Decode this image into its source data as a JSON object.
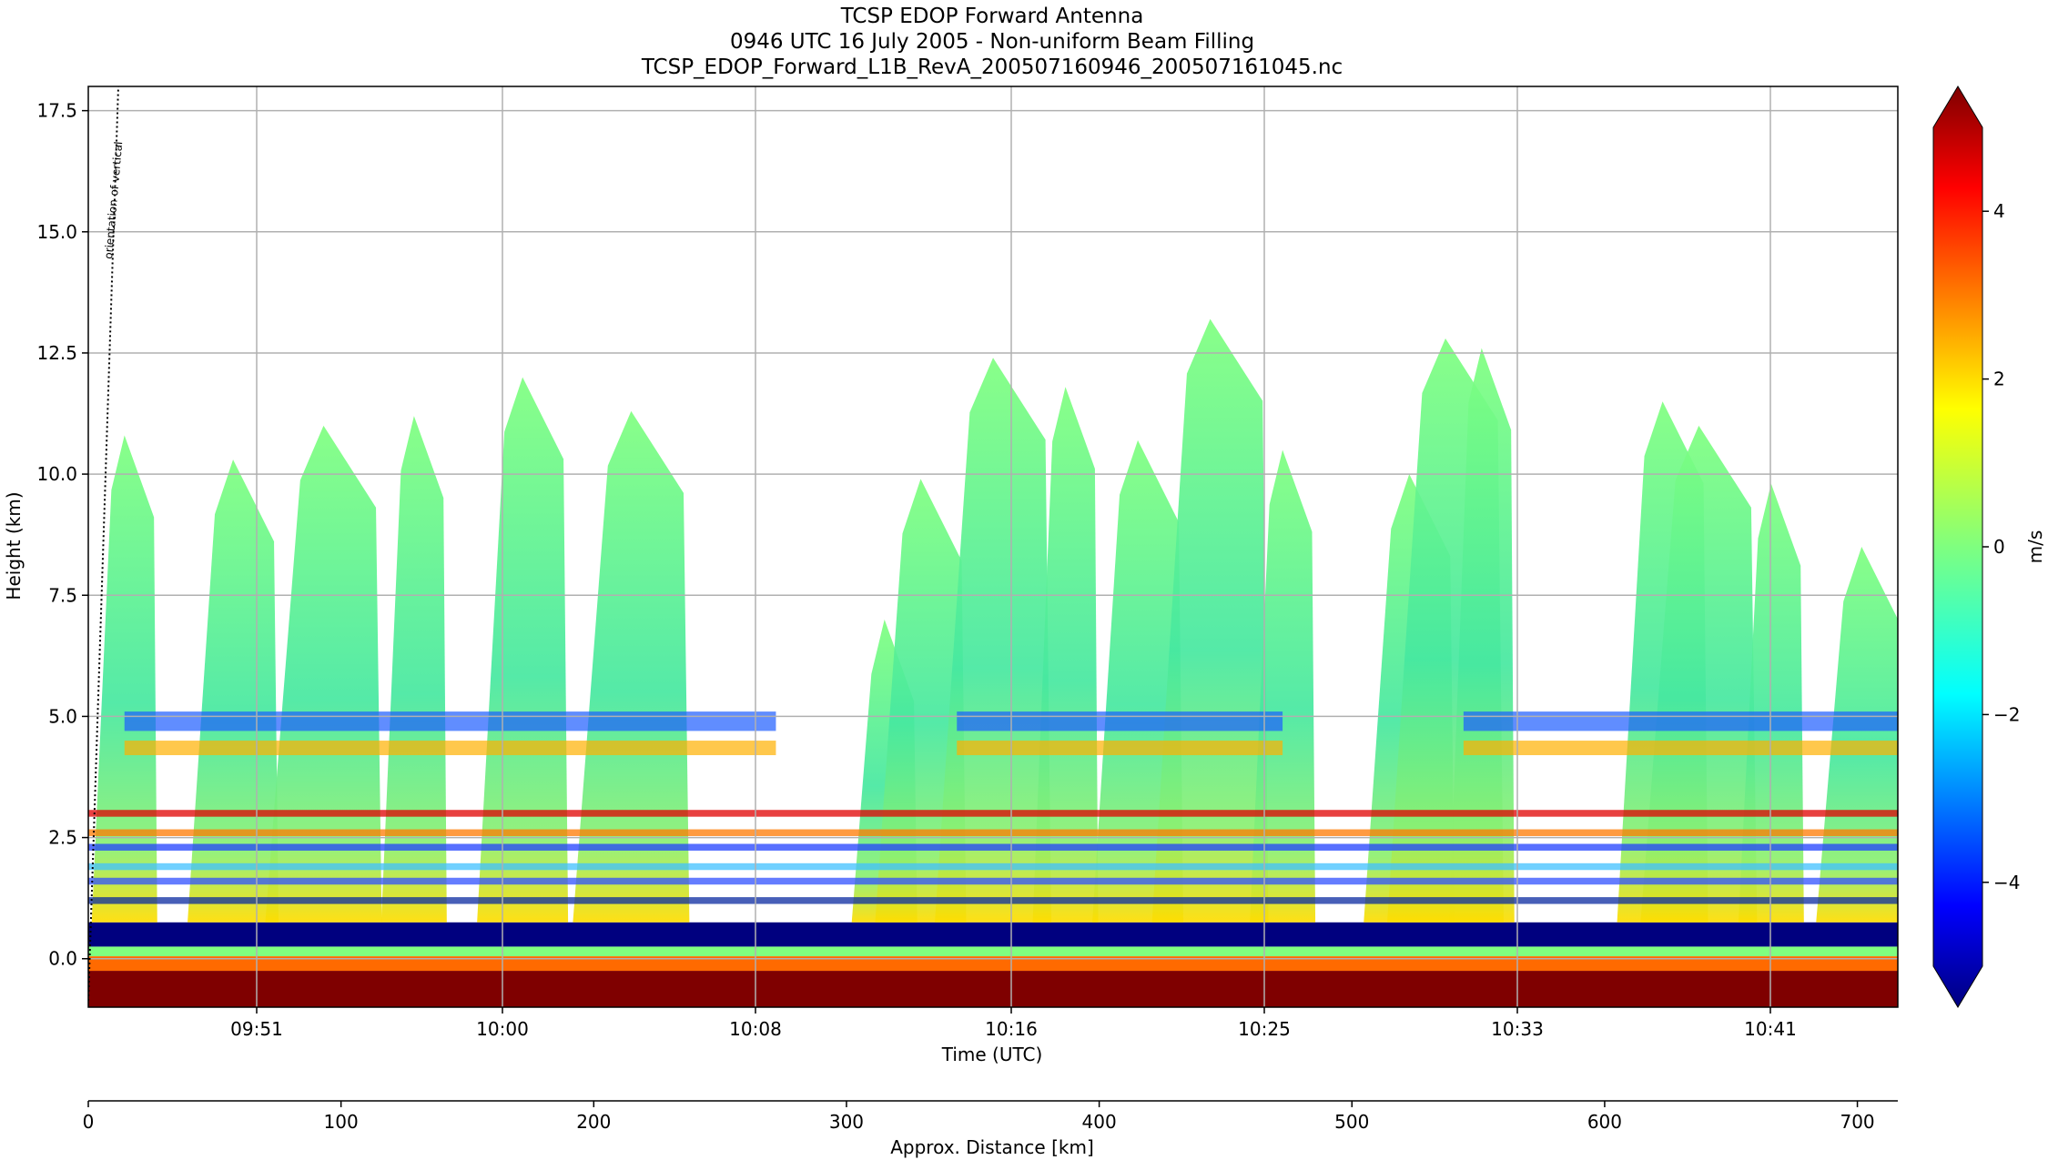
{
  "chart_data": {
    "type": "heatmap",
    "title_lines": [
      "TCSP EDOP Forward Antenna",
      "0946 UTC 16 July 2005 - Non-uniform Beam Filling",
      "TCSP_EDOP_Forward_L1B_RevA_200507160946_200507161045.nc"
    ],
    "xlabel": "Time (UTC)",
    "ylabel": "Height (km)",
    "x_ticks": [
      "09:51",
      "10:00",
      "10:08",
      "10:16",
      "10:25",
      "10:33",
      "10:41"
    ],
    "y_ticks": [
      0.0,
      2.5,
      5.0,
      7.5,
      10.0,
      12.5,
      15.0,
      17.5
    ],
    "y_tick_labels": [
      "0.0",
      "2.5",
      "5.0",
      "7.5",
      "10.0",
      "12.5",
      "15.0",
      "17.5"
    ],
    "ylim": [
      -1.0,
      18.0
    ],
    "grid": true,
    "colorbar": {
      "label": "m/s",
      "range": [
        -5,
        5
      ],
      "ticks": [
        -4,
        -2,
        0,
        2,
        4
      ],
      "tick_labels": [
        "−4",
        "−2",
        "0",
        "2",
        "4"
      ],
      "colormap": "jet",
      "extend": "both"
    },
    "secondary_axis": {
      "label": "Approx. Distance [km]",
      "ticks": [
        0,
        100,
        200,
        300,
        400,
        500,
        600,
        700
      ],
      "range": [
        0,
        716
      ]
    },
    "annotation": "orientation of vertical",
    "cloud_columns_x": [
      2,
      8,
      13,
      18,
      24,
      30,
      44,
      46,
      50,
      54,
      58,
      62,
      66,
      73,
      75,
      77,
      87,
      89,
      93,
      98
    ],
    "cloud_columns_top_km": [
      10.8,
      10.3,
      11.0,
      11.2,
      12.0,
      11.3,
      7.0,
      9.9,
      12.4,
      11.8,
      10.7,
      13.2,
      10.5,
      10.0,
      12.8,
      12.6,
      11.5,
      11.0,
      9.8,
      8.5
    ],
    "echo_layers_km": [
      3.0,
      2.6,
      2.3,
      1.9,
      1.6,
      1.2
    ]
  }
}
